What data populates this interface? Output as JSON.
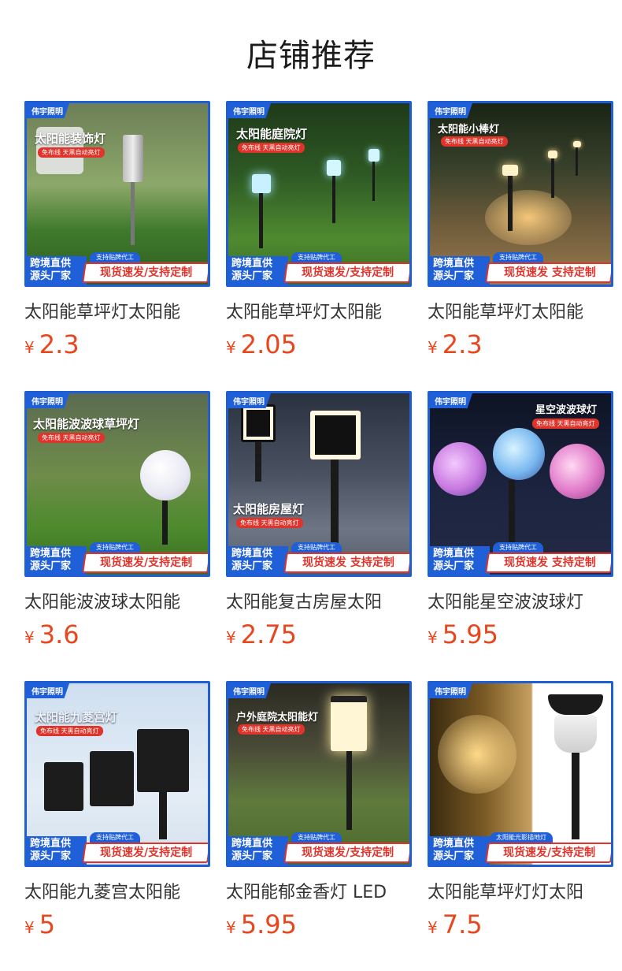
{
  "page": {
    "title": "店铺推荐"
  },
  "common": {
    "brand": "伟宇照明",
    "bar_left_line1": "跨境直供",
    "bar_left_line2": "源头厂家",
    "bar_small": "支持贴牌代工",
    "bar_small_alt": "太阳能光影插地灯",
    "currency": "¥",
    "colors": {
      "accent": "#1f5fd8",
      "price": "#e8461d",
      "badge": "#e0332a"
    }
  },
  "products": [
    {
      "name": "太阳能草坪灯太阳能",
      "price": "2.3",
      "img_title": "太阳能装饰灯",
      "img_sub": "免布线 天黑自动亮灯",
      "bar_right": "现货速发/支持定制"
    },
    {
      "name": "太阳能草坪灯太阳能",
      "price": "2.05",
      "img_title": "太阳能庭院灯",
      "img_sub": "免布线 天黑自动亮灯",
      "bar_right": "现货速发/支持定制"
    },
    {
      "name": "太阳能草坪灯太阳能",
      "price": "2.3",
      "img_title": "太阳能小棒灯",
      "img_sub": "免布线 天黑自动亮灯",
      "bar_right": "现货速发 支持定制"
    },
    {
      "name": "太阳能波波球太阳能",
      "price": "3.6",
      "img_title": "太阳能波波球草坪灯",
      "img_sub": "免布线 天黑自动亮灯",
      "bar_right": "现货速发/支持定制"
    },
    {
      "name": "太阳能复古房屋太阳",
      "price": "2.75",
      "img_title": "太阳能房屋灯",
      "img_sub": "免布线 天黑自动亮灯",
      "bar_right": "现货速发 支持定制"
    },
    {
      "name": "太阳能星空波波球灯",
      "price": "5.95",
      "img_title": "星空波波球灯",
      "img_sub": "免布线 天黑自动亮灯",
      "bar_right": "现货速发 支持定制"
    },
    {
      "name": "太阳能九菱宫太阳能",
      "price": "5",
      "img_title": "太阳能九菱宫灯",
      "img_sub": "免布线 天黑自动亮灯",
      "bar_right": "现货速发/支持定制"
    },
    {
      "name": "太阳能郁金香灯 LED",
      "price": "5.95",
      "img_title": "户外庭院太阳能灯",
      "img_sub": "免布线 天黑自动亮灯",
      "bar_right": "现货速发/支持定制"
    },
    {
      "name": "太阳能草坪灯灯太阳",
      "price": "7.5",
      "img_title": "",
      "img_sub": "",
      "bar_right": "现货速发/支持定制"
    }
  ]
}
